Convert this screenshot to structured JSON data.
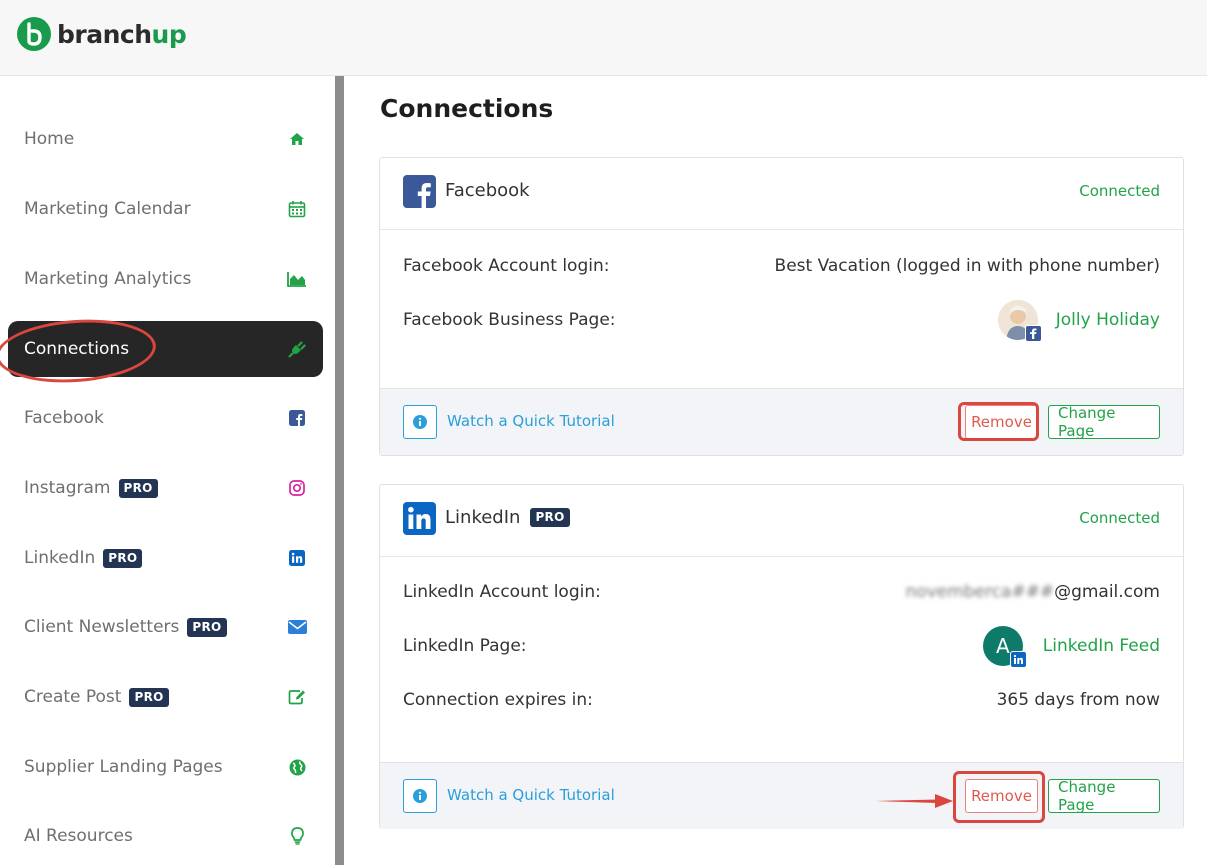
{
  "app": {
    "logo_prefix": "branch",
    "logo_suffix": "up"
  },
  "sidebar": {
    "items": [
      {
        "label": "Home",
        "icon": "home-icon"
      },
      {
        "label": "Marketing Calendar",
        "icon": "calendar-icon"
      },
      {
        "label": "Marketing Analytics",
        "icon": "area-chart-icon"
      },
      {
        "label": "Connections",
        "icon": "plug-icon",
        "active": true
      },
      {
        "label": "Facebook",
        "icon": "facebook-icon"
      },
      {
        "label": "Instagram",
        "icon": "instagram-icon",
        "badge": "PRO"
      },
      {
        "label": "LinkedIn",
        "icon": "linkedin-icon",
        "badge": "PRO"
      },
      {
        "label": "Client Newsletters",
        "icon": "envelope-icon",
        "badge": "PRO"
      },
      {
        "label": "Create Post",
        "icon": "edit-icon",
        "badge": "PRO"
      },
      {
        "label": "Supplier Landing Pages",
        "icon": "globe-icon"
      },
      {
        "label": "AI Resources",
        "icon": "lightbulb-icon"
      }
    ]
  },
  "main": {
    "title": "Connections",
    "facebook_card": {
      "name": "Facebook",
      "status": "Connected",
      "rows": [
        {
          "label": "Facebook Account login:",
          "value": "Best Vacation (logged in with phone number)"
        },
        {
          "label": "Facebook Business Page:",
          "value": "Jolly Holiday"
        }
      ],
      "tutorial": "Watch a Quick Tutorial",
      "remove": "Remove",
      "change": "Change Page"
    },
    "linkedin_card": {
      "name": "LinkedIn",
      "badge": "PRO",
      "status": "Connected",
      "rows": [
        {
          "label": "LinkedIn Account login:",
          "value_blurred": "novemberca###",
          "value_suffix": "@gmail.com"
        },
        {
          "label": "LinkedIn Page:",
          "value": "LinkedIn Feed",
          "avatar_letter": "A"
        },
        {
          "label": "Connection expires in:",
          "value": "365 days from now"
        }
      ],
      "tutorial": "Watch a Quick Tutorial",
      "remove": "Remove",
      "change": "Change Page"
    }
  },
  "colors": {
    "accent_green": "#21a348",
    "link_blue": "#2a9fd8",
    "danger_red": "#e05a50",
    "pro_badge": "#233552",
    "facebook_blue": "#3b5998",
    "linkedin_blue": "#0a66c2",
    "annotation_red": "#d9473f"
  }
}
